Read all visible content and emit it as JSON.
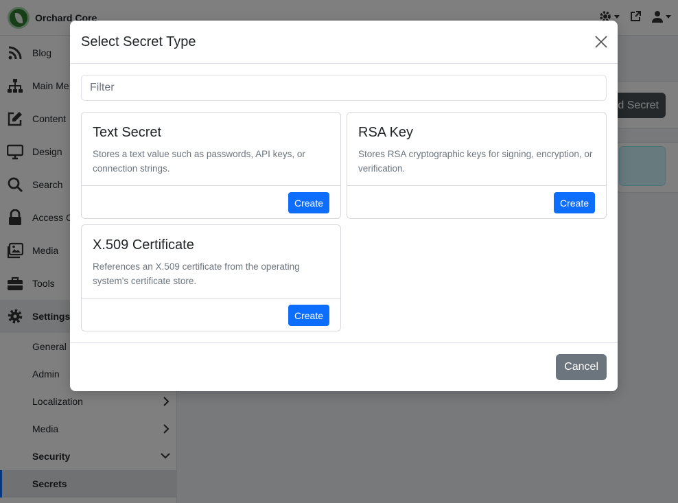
{
  "app": {
    "brand_name": "Orchard Core"
  },
  "topbar": {
    "icons": [
      "gear-icon",
      "external-link-icon",
      "user-icon"
    ]
  },
  "sidebar": {
    "items": [
      {
        "label": "Blog",
        "icon": "rss-icon"
      },
      {
        "label": "Main Me",
        "icon": "sitemap-icon"
      },
      {
        "label": "Content",
        "icon": "edit-icon"
      },
      {
        "label": "Design",
        "icon": "desktop-icon"
      },
      {
        "label": "Search",
        "icon": "search-icon"
      },
      {
        "label": "Access C",
        "icon": "lock-icon"
      },
      {
        "label": "Media",
        "icon": "images-icon"
      },
      {
        "label": "Tools",
        "icon": "toolbox-icon"
      },
      {
        "label": "Settings",
        "icon": "cog-icon"
      }
    ],
    "sub_items": [
      {
        "label": "General"
      },
      {
        "label": "Admin"
      },
      {
        "label": "Localization"
      },
      {
        "label": "Media"
      },
      {
        "label": "Security"
      },
      {
        "label": "Secrets"
      }
    ]
  },
  "main": {
    "add_button_label": "d Secret"
  },
  "modal": {
    "title": "Select Secret Type",
    "filter_placeholder": "Filter",
    "cards": [
      {
        "title": "Text Secret",
        "description": "Stores a text value such as passwords, API keys, or connection strings.",
        "button": "Create"
      },
      {
        "title": "RSA Key",
        "description": "Stores RSA cryptographic keys for signing, encryption, or verification.",
        "button": "Create"
      },
      {
        "title": "X.509 Certificate",
        "description": "References an X.509 certificate from the operating system's certificate store.",
        "button": "Create"
      }
    ],
    "cancel_label": "Cancel"
  },
  "colors": {
    "primary": "#0d6efd",
    "secondary": "#6c757d",
    "brand": "#2e7d32",
    "backdrop": "rgba(0,0,0,0.5)"
  }
}
